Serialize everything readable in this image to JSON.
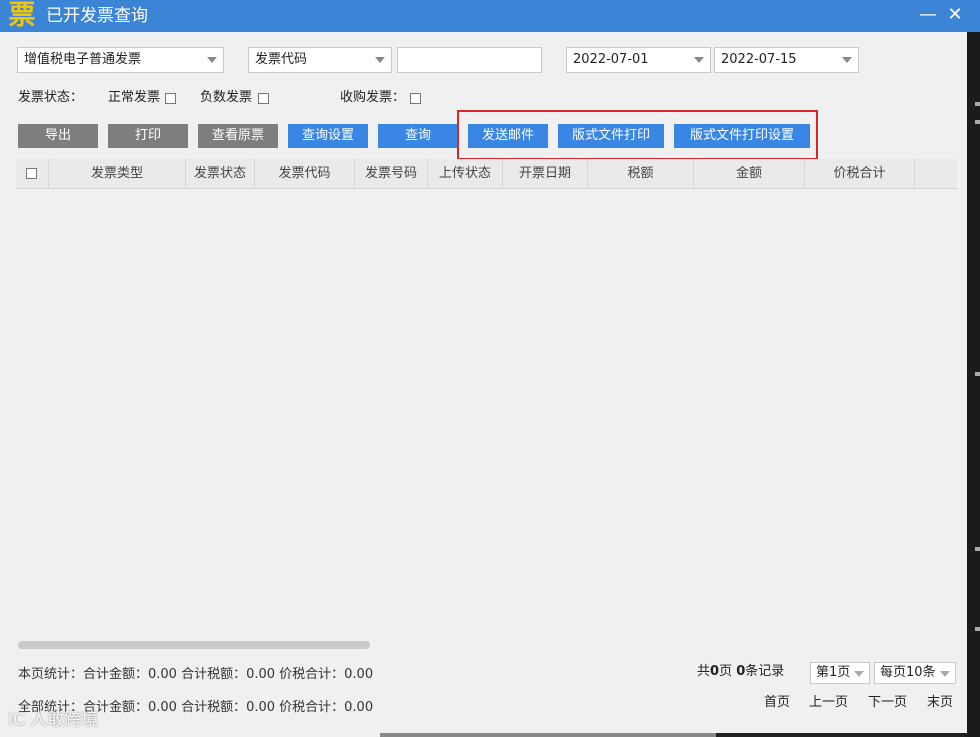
{
  "window": {
    "title": "已开发票查询",
    "logo_char": "票",
    "min_icon": "—",
    "close_icon": "✕"
  },
  "filters": {
    "invoice_type": "增值税电子普通发票",
    "search_field": "发票代码",
    "search_value": "",
    "date_from": "2022-07-01",
    "date_to": "2022-07-15"
  },
  "status": {
    "label": "发票状态：",
    "normal": "正常发票",
    "negative": "负数发票",
    "purchase": "收购发票："
  },
  "toolbar": {
    "export": "导出",
    "print": "打印",
    "view_original": "查看原票",
    "query_settings": "查询设置",
    "query": "查询",
    "send_email": "发送邮件",
    "layout_print": "版式文件打印",
    "layout_print_settings": "版式文件打印设置"
  },
  "table": {
    "columns": [
      "发票类型",
      "发票状态",
      "发票代码",
      "发票号码",
      "上传状态",
      "开票日期",
      "税额",
      "金额",
      "价税合计"
    ]
  },
  "summary": {
    "page_stats": "本页统计：合计金额：0.00  合计税额：0.00   价税合计：0.00",
    "all_stats": "全部统计：合计金额：0.00  合计税额：0.00   价税合计：0.00"
  },
  "pagination": {
    "total_prefix": "共",
    "total_pages": "0",
    "pages_unit": "页",
    "total_records": "0",
    "records_unit": "条记录",
    "current_page": "第1页",
    "page_size": "每页10条",
    "first": "首页",
    "prev": "上一页",
    "next": "下一页",
    "last": "末页"
  },
  "watermark": "IC 人敢跨境"
}
